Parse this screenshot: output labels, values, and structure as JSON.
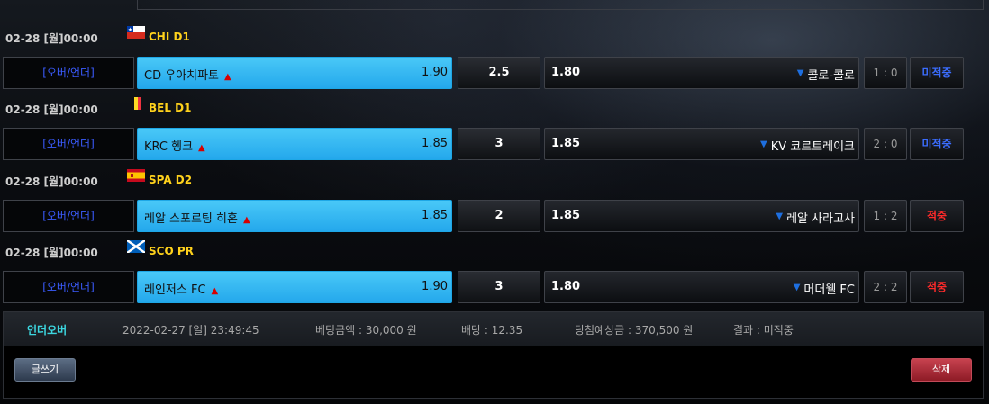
{
  "matches": [
    {
      "date": "02-28 [월]00:00",
      "flag": "chile-flag",
      "league": "CHI D1",
      "bet_type": "[오버/언더]",
      "home_team": "CD 우아치파토",
      "home_odds": "1.90",
      "line": "2.5",
      "away_odds": "1.80",
      "away_team": "콜로-콜로",
      "score": "1 : 0",
      "result": "미적중"
    },
    {
      "date": "02-28 [월]00:00",
      "flag": "belgium-flag",
      "league": "BEL D1",
      "bet_type": "[오버/언더]",
      "home_team": "KRC 헹크",
      "home_odds": "1.85",
      "line": "3",
      "away_odds": "1.85",
      "away_team": "KV 코르트레이크",
      "score": "2 : 0",
      "result": "미적중"
    },
    {
      "date": "02-28 [월]00:00",
      "flag": "spain-flag",
      "league": "SPA D2",
      "bet_type": "[오버/언더]",
      "home_team": "레알 스포르팅 히혼",
      "home_odds": "1.85",
      "line": "2",
      "away_odds": "1.85",
      "away_team": "레알 사라고사",
      "score": "1 : 2",
      "result": "적중"
    },
    {
      "date": "02-28 [월]00:00",
      "flag": "scotland-flag",
      "league": "SCO PR",
      "bet_type": "[오버/언더]",
      "home_team": "레인저스 FC",
      "home_odds": "1.90",
      "line": "3",
      "away_odds": "1.80",
      "away_team": "머더웰 FC",
      "score": "2 : 2",
      "result": "적중"
    }
  ],
  "summary": {
    "type": "언더오버",
    "datetime": "2022-02-27 [일] 23:49:45",
    "bet_amount": "베팅금액 : 30,000 원",
    "odds": "배당 : 12.35",
    "expected_win": "당첨예상금 : 370,500 원",
    "result": "결과 : 미적중"
  },
  "buttons": {
    "write": "글쓰기",
    "delete": "삭제"
  },
  "colors": {
    "league": "#ffd21c",
    "bet_type": "#3b5cff",
    "home_bg": "#33b8f2",
    "pending": "#3b6dff",
    "hit": "#ff2a2a"
  }
}
